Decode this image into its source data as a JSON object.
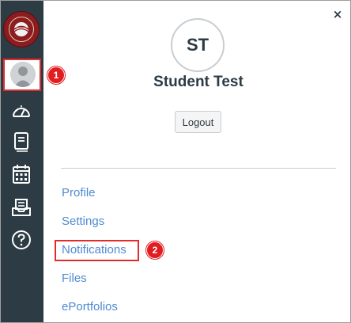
{
  "account": {
    "initials": "ST",
    "name": "Student Test",
    "logout_label": "Logout"
  },
  "tray": {
    "close_glyph": "×"
  },
  "menu": {
    "items": [
      {
        "label": "Profile"
      },
      {
        "label": "Settings"
      },
      {
        "label": "Notifications"
      },
      {
        "label": "Files"
      },
      {
        "label": "ePortfolios"
      }
    ]
  },
  "callouts": {
    "step1": "1",
    "step2": "2"
  },
  "nav": {
    "logo_icon": "university-seal-icon",
    "items": [
      {
        "icon": "account-avatar-icon"
      },
      {
        "icon": "dashboard-icon"
      },
      {
        "icon": "courses-icon"
      },
      {
        "icon": "calendar-icon"
      },
      {
        "icon": "inbox-icon"
      },
      {
        "icon": "help-icon"
      }
    ]
  },
  "colors": {
    "nav_bg": "#2d3b45",
    "link": "#4f8ad0",
    "highlight": "#e22b2b",
    "callout": "#e11d21",
    "logo": "#8b1c20"
  }
}
